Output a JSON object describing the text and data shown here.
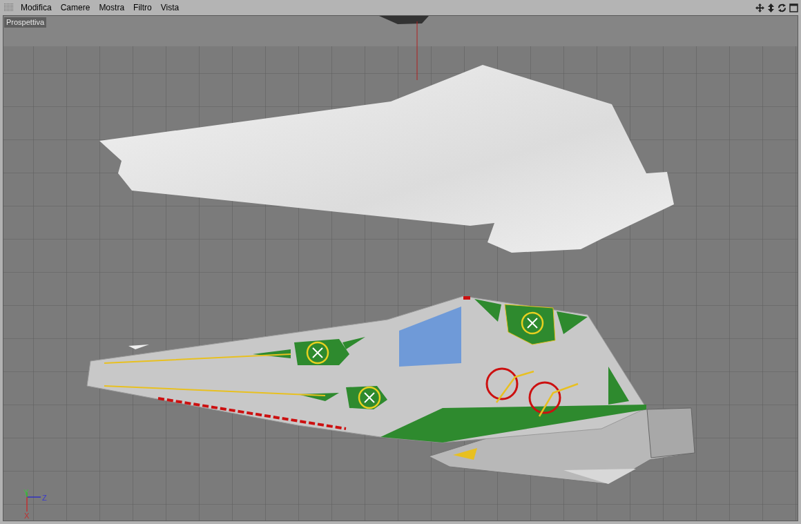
{
  "menu": [
    "Modifica",
    "Camere",
    "Mostra",
    "Filtro",
    "Vista"
  ],
  "viewport": {
    "label": "Prospettiva",
    "axis_labels": [
      "Y",
      "Z",
      "X"
    ]
  }
}
